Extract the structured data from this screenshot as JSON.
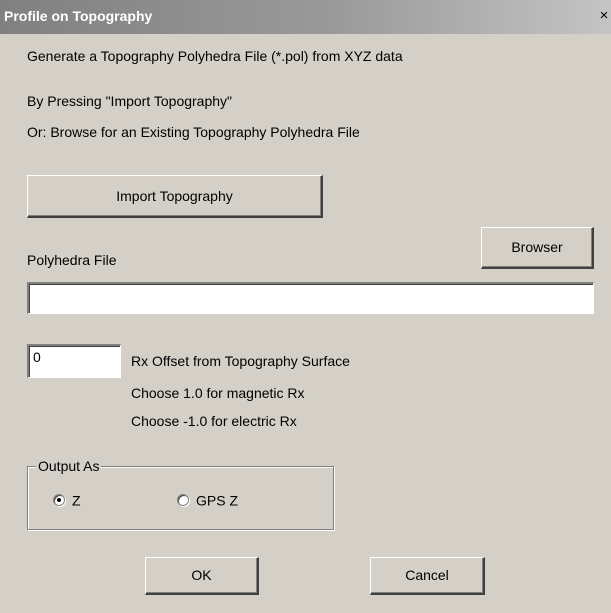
{
  "window": {
    "title": "Profile on Topography",
    "close_glyph": "×"
  },
  "instructions": {
    "line1": "Generate a Topography Polyhedra File (*.pol) from XYZ data",
    "line2": "By Pressing \"Import Topography\"",
    "line3": "Or:  Browse for an Existing Topography Polyhedra File"
  },
  "buttons": {
    "import_label": "Import Topography",
    "browser_label": "Browser",
    "ok_label": "OK",
    "cancel_label": "Cancel"
  },
  "polyhedra": {
    "label": "Polyhedra File",
    "value": ""
  },
  "rx_offset": {
    "value": "0",
    "label": "Rx Offset from Topography Surface",
    "hint_magnetic": "Choose 1.0 for magnetic Rx",
    "hint_electric": "Choose -1.0 for electric Rx"
  },
  "output": {
    "legend": "Output As",
    "options": [
      {
        "label": "Z",
        "selected": true
      },
      {
        "label": "GPS Z",
        "selected": false
      }
    ]
  },
  "colors": {
    "dialog_bg": "#d4d0c8",
    "titlebar_start": "#808080",
    "titlebar_end": "#c4c4c4",
    "title_text": "#ffffff"
  },
  "icons": {
    "close": "close-icon",
    "radio_selected": "radio-selected-icon",
    "radio_unselected": "radio-unselected-icon"
  }
}
